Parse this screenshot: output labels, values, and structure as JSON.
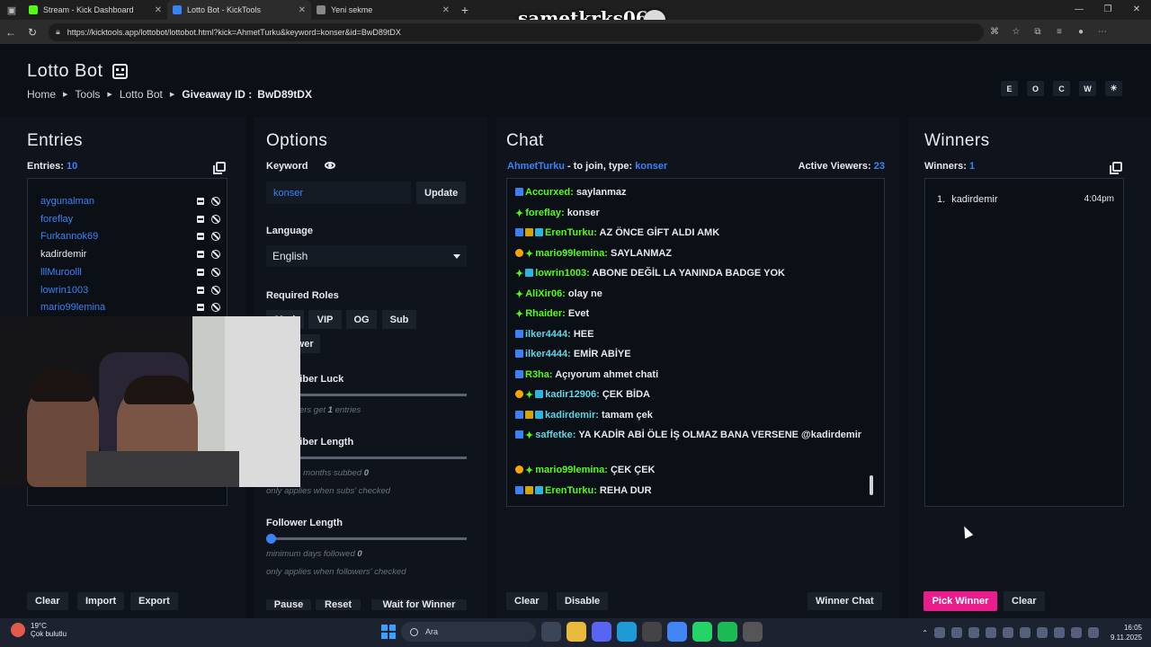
{
  "browser": {
    "tabs": [
      {
        "title": "Stream - Kick Dashboard",
        "favicon_color": "#53fc18",
        "active": false
      },
      {
        "title": "Lotto Bot - KickTools",
        "favicon_color": "#3b82f6",
        "active": true
      },
      {
        "title": "Yeni sekme",
        "favicon_color": "#888888",
        "active": false
      }
    ],
    "url": "https://kicktools.app/lottobot/lottobot.html?kick=AhmetTurku&keyword=konser&id=BwD89tDX",
    "overlay_name": "sametkrks06"
  },
  "header": {
    "title": "Lotto Bot",
    "breadcrumb": [
      "Home",
      "Tools",
      "Lotto Bot"
    ],
    "giveaway_label": "Giveaway ID :",
    "giveaway_id": "BwD89tDX",
    "top_buttons": [
      "E",
      "O",
      "C",
      "W",
      "☀"
    ]
  },
  "entries": {
    "title": "Entries",
    "count_label": "Entries:",
    "count": "10",
    "items": [
      {
        "name": "aygunalman",
        "color": "#3b82f6"
      },
      {
        "name": "foreflay",
        "color": "#3b82f6"
      },
      {
        "name": "Furkannok69",
        "color": "#3b82f6"
      },
      {
        "name": "kadirdemir",
        "color": "#e6e8ec"
      },
      {
        "name": "lllMuroolll",
        "color": "#3b82f6"
      },
      {
        "name": "lowrin1003",
        "color": "#3b82f6"
      },
      {
        "name": "mario99lemina",
        "color": "#3b82f6"
      }
    ],
    "buttons": {
      "clear": "Clear",
      "import": "Import",
      "export": "Export"
    }
  },
  "options": {
    "title": "Options",
    "keyword_label": "Keyword",
    "keyword_value": "konser",
    "update_label": "Update",
    "language_label": "Language",
    "language_value": "English",
    "roles_label": "Required Roles",
    "roles": [
      "Mod",
      "VIP",
      "OG",
      "Sub"
    ],
    "follower_role": "Follower",
    "sub_luck_label": "Subscriber Luck",
    "sub_luck_hint_pre": "Subscribers get",
    "sub_luck_hint_val": "1",
    "sub_luck_hint_post": "entries",
    "sub_length_label": "Subscriber Length",
    "sub_length_hint_pre": "minimum months subbed",
    "sub_length_hint_val": "0",
    "sub_length_note": "only applies when subs' checked",
    "follower_length_label": "Follower Length",
    "follower_length_hint_pre": "minimum days followed",
    "follower_length_hint_val": "0",
    "follower_length_note": "only applies when followers' checked",
    "bottom_buttons": [
      "Pause",
      "Reset",
      "Wait for Winner"
    ]
  },
  "chat": {
    "title": "Chat",
    "channel": "AhmetTurku",
    "join_text": " - to join, type: ",
    "keyword": "konser",
    "viewers_label": "Active Viewers:",
    "viewers": "23",
    "messages": [
      {
        "user": "Accurxed:",
        "text": "saylanmaz",
        "badges": [
          "mod"
        ],
        "ucolor": "green"
      },
      {
        "user": "foreflay:",
        "text": "konser",
        "badges": [
          "star"
        ],
        "ucolor": "green"
      },
      {
        "user": "ErenTurku:",
        "text": "AZ ÖNCE GİFT ALDI AMK",
        "badges": [
          "mod",
          "crown",
          "sub"
        ],
        "ucolor": "green"
      },
      {
        "user": "mario99lemina:",
        "text": "SAYLANMAZ",
        "badges": [
          "og",
          "star"
        ],
        "ucolor": "green"
      },
      {
        "user": "lowrin1003:",
        "text": "ABONE DEĞİL LA YANINDA BADGE YOK",
        "badges": [
          "star",
          "sub"
        ],
        "ucolor": "green"
      },
      {
        "user": "AliXir06:",
        "text": "olay ne",
        "badges": [
          "star"
        ],
        "ucolor": "green"
      },
      {
        "user": "Rhaider:",
        "text": "Evet",
        "badges": [
          "star"
        ],
        "ucolor": "green"
      },
      {
        "user": "ilker4444:",
        "text": "HEE",
        "badges": [
          "mod"
        ],
        "ucolor": "cyan"
      },
      {
        "user": "ilker4444:",
        "text": "EMİR ABİYE",
        "badges": [
          "mod"
        ],
        "ucolor": "cyan"
      },
      {
        "user": "R3ha:",
        "text": "Açıyorum ahmet chati",
        "badges": [
          "mod"
        ],
        "ucolor": "green"
      },
      {
        "user": "kadir12906:",
        "text": "ÇEK BİDA",
        "badges": [
          "og",
          "star",
          "sub"
        ],
        "ucolor": "cyan"
      },
      {
        "user": "kadirdemir:",
        "text": "tamam çek",
        "badges": [
          "mod",
          "crown",
          "sub"
        ],
        "ucolor": "cyan"
      },
      {
        "user": "saffetke:",
        "text": "YA KADİR ABİ ÖLE İŞ OLMAZ BANA VERSENE @kadirdemir",
        "badges": [
          "mod",
          "star"
        ],
        "ucolor": "cyan"
      },
      {
        "user": "mario99lemina:",
        "text": "ÇEK ÇEK",
        "badges": [
          "og",
          "star"
        ],
        "ucolor": "green"
      },
      {
        "user": "ErenTurku:",
        "text": "REHA DUR",
        "badges": [
          "mod",
          "crown",
          "sub"
        ],
        "ucolor": "green"
      }
    ],
    "buttons": {
      "clear": "Clear",
      "disable": "Disable",
      "winner_chat": "Winner Chat"
    }
  },
  "winners": {
    "title": "Winners",
    "count_label": "Winners:",
    "count": "1",
    "list": [
      {
        "num": "1.",
        "name": "kadirdemir",
        "time": "4:04pm"
      }
    ],
    "pick_label": "Pick Winner",
    "clear_label": "Clear"
  },
  "taskbar": {
    "temp": "19°C",
    "weather": "Çok bulutlu",
    "search_placeholder": "Ara",
    "time": "16:05",
    "date": "9.11.2025"
  }
}
